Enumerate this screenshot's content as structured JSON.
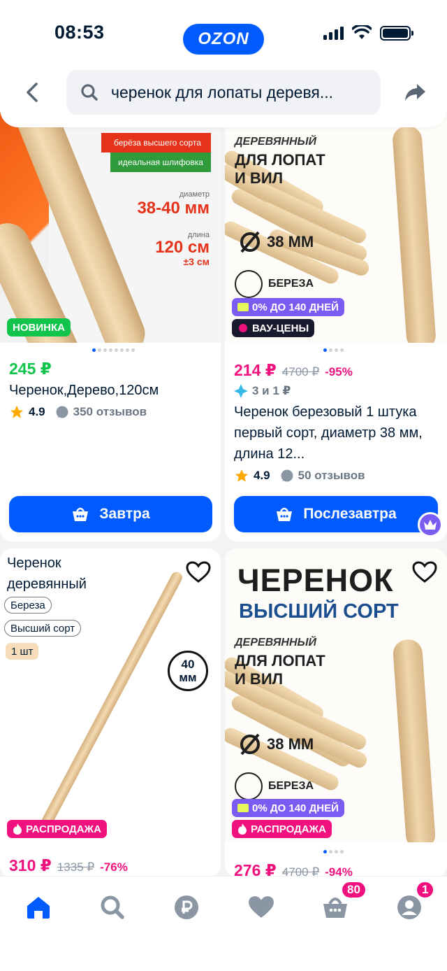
{
  "status_bar": {
    "time": "08:53"
  },
  "header": {
    "logo": "OZON",
    "search_query": "черенок для лопаты деревя..."
  },
  "colors": {
    "accent": "#005bff",
    "sale_pink": "#f1117e",
    "new_green": "#10c44c",
    "violet": "#7b5cf2"
  },
  "products": [
    {
      "image_text": {
        "tag1": "берёза высшего сорта",
        "tag2": "идеальная шлифовка",
        "diam_label": "диаметр",
        "diam_value": "38-40 мм",
        "len_label": "длина",
        "len_value": "120 см",
        "len_tol": "±3 см"
      },
      "badge": "НОВИНКА",
      "price": "245 ₽",
      "title": "Черенок,Дерево,120см",
      "rating": "4.9",
      "reviews": "350 отзывов",
      "cta": "Завтра"
    },
    {
      "image_text": {
        "h1": "ДЕРЕВЯННЫЙ",
        "h2": "ДЛЯ ЛОПАТ",
        "h3": "И ВИЛ",
        "diameter": "38 ММ",
        "material": "БЕРЕЗА"
      },
      "badges": [
        "0% ДО 140 ДНЕЙ",
        "ВАУ-ЦЕНЫ"
      ],
      "price": "214 ₽",
      "old_price": "4700 ₽",
      "discount": "-95%",
      "installment": "3 и 1 ₽",
      "title": "Черенок березовый 1 штука первый сорт, диаметр 38 мм, длина 12...",
      "rating": "4.9",
      "reviews": "50 отзывов",
      "cta": "Послезавтра"
    },
    {
      "title_line1": "Черенок",
      "title_line2": "деревянный",
      "chips": [
        "Береза",
        "Высший сорт"
      ],
      "qty_chip": "1 шт",
      "size_line1": "40",
      "size_line2": "мм",
      "badge": "РАСПРОДАЖА",
      "price": "310 ₽",
      "old_price": "1335 ₽",
      "discount": "-76%"
    },
    {
      "image_text": {
        "big": "ЧЕРЕНОК",
        "sub": "ВЫСШИЙ СОРТ",
        "h1": "ДЕРЕВЯННЫЙ",
        "h2": "ДЛЯ ЛОПАТ",
        "h3": "И ВИЛ",
        "diameter": "38 ММ",
        "material": "БЕРЕЗА"
      },
      "badges": [
        "0% ДО 140 ДНЕЙ",
        "РАСПРОДАЖА"
      ],
      "price": "276 ₽",
      "old_price": "4700 ₽",
      "discount": "-94%"
    }
  ],
  "bottom_nav": {
    "items": [
      "home-icon",
      "search-icon",
      "ruble-icon",
      "heart-icon",
      "cart-icon",
      "profile-icon"
    ],
    "cart_count": "80",
    "profile_count": "1"
  }
}
